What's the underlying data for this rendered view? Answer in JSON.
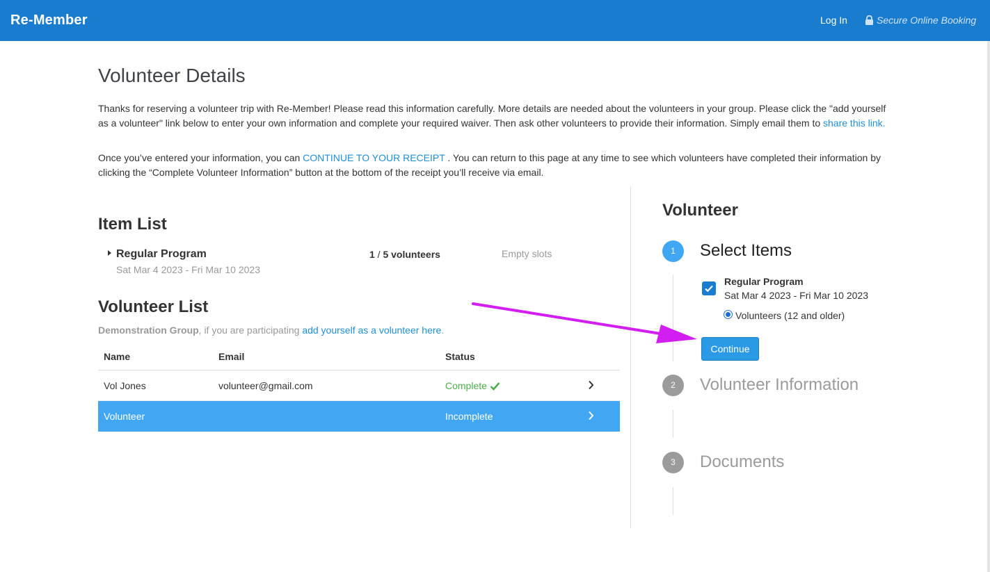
{
  "header": {
    "brand": "Re-Member",
    "login_label": "Log In",
    "secure_label": "Secure Online Booking",
    "colors": {
      "bar": "#1a7ccf"
    }
  },
  "main": {
    "title": "Volunteer Details",
    "intro1_text": "Thanks for reserving a volunteer trip with Re-Member! Please read this information carefully. More details are needed about the volunteers in your group. Please click the \"add yourself as a volunteer\" link below to enter your own information and complete your required waiver. Then ask other volunteers to provide their information. Simply email them to ",
    "intro1_link": "share this link.",
    "intro2_before": "Once you’ve entered your information, you can ",
    "intro2_link": "CONTINUE TO YOUR RECEIPT",
    "intro2_after": " . You can return to this page at any time to see which volunteers have completed their information by clicking the “Complete Volunteer Information” button at the bottom of the receipt you’ll receive via email."
  },
  "item_list": {
    "title": "Item List",
    "item": {
      "name": "Regular Program",
      "dates": "Sat Mar 4 2023 - Fri Mar 10 2023",
      "count_filled": "1",
      "count_sep": " / ",
      "count_total": "5 volunteers",
      "empty_label": "Empty slots"
    }
  },
  "volunteer_list": {
    "title": "Volunteer List",
    "group_name": "Demonstration Group",
    "group_suffix": ", if you are participating ",
    "add_link": "add yourself as a volunteer here",
    "add_link_end": ".",
    "columns": {
      "name": "Name",
      "email": "Email",
      "status": "Status"
    },
    "rows": [
      {
        "name": "Vol Jones",
        "email": "volunteer@gmail.com",
        "status": "Complete",
        "selected": false
      },
      {
        "name": "Volunteer",
        "email": "",
        "status": "Incomplete",
        "selected": true
      }
    ]
  },
  "panel": {
    "title": "Volunteer",
    "steps": [
      {
        "number": "1",
        "title": "Select Items",
        "active": true
      },
      {
        "number": "2",
        "title": "Volunteer Information",
        "active": false
      },
      {
        "number": "3",
        "title": "Documents",
        "active": false
      }
    ],
    "selection": {
      "item_name": "Regular Program",
      "item_dates": "Sat Mar 4 2023 - Fri Mar 10 2023",
      "checked": true,
      "radio_label": "Volunteers (12 and older)"
    },
    "continue_label": "Continue"
  },
  "annotation": {
    "arrow_color": "#d21ef0"
  }
}
